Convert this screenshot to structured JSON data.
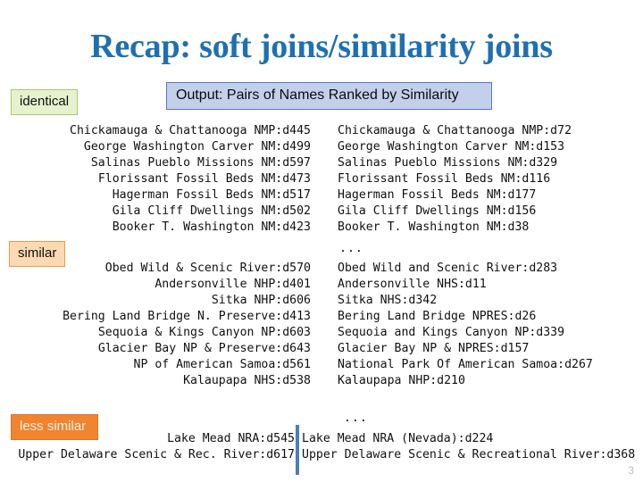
{
  "slide": {
    "title": "Recap: soft joins/similarity joins",
    "page_number": "3",
    "title_color": "#1F6FB2"
  },
  "callouts": {
    "identical": {
      "label": "identical",
      "fill": "#E6F2CE",
      "stroke": "#AFC66A"
    },
    "output": {
      "label": "Output:  Pairs of Names Ranked by Similarity",
      "fill": "#C3CFEB",
      "stroke": "#5578C2"
    },
    "similar": {
      "label": "similar",
      "fill": "#FBD9B3",
      "stroke": "#E89A4B"
    },
    "less_similar": {
      "label": "less similar",
      "fill": "#F0842F",
      "stroke": "#DE7722"
    }
  },
  "markers": {
    "ellipsis_middle": "...",
    "ellipsis_bottom": "..."
  },
  "listings": {
    "identical": {
      "left": [
        "Chickamauga & Chattanooga NMP:d445",
        "George Washington Carver NM:d499",
        "Salinas Pueblo Missions NM:d597",
        "Florissant Fossil Beds NM:d473",
        "Hagerman Fossil Beds NM:d517",
        "Gila Cliff Dwellings NM:d502",
        "Booker T. Washington NM:d423"
      ],
      "right": [
        "Chickamauga & Chattanooga NMP:d72",
        "George Washington Carver NM:d153",
        "Salinas Pueblo Missions NM:d329",
        "Florissant Fossil Beds NM:d116",
        "Hagerman Fossil Beds NM:d177",
        "Gila Cliff Dwellings NM:d156",
        "Booker T. Washington NM:d38"
      ]
    },
    "similar": {
      "left": [
        "Obed Wild & Scenic River:d570",
        "Andersonville NHP:d401",
        "Sitka NHP:d606",
        "Bering Land Bridge N. Preserve:d413",
        "Sequoia & Kings Canyon NP:d603",
        "Glacier Bay NP & Preserve:d643",
        "NP of American Samoa:d561",
        "Kalaupapa NHS:d538"
      ],
      "right": [
        "Obed Wild and Scenic River:d283",
        "Andersonville NHS:d11",
        "Sitka NHS:d342",
        "Bering Land Bridge NPRES:d26",
        "Sequoia and Kings Canyon NP:d339",
        "Glacier Bay NP & NPRES:d157",
        "National Park Of American Samoa:d267",
        "Kalaupapa NHP:d210"
      ]
    },
    "less_similar": {
      "left": [
        "Lake Mead NRA:d545",
        "Upper Delaware Scenic & Rec. River:d617"
      ],
      "right": [
        "Lake Mead NRA (Nevada):d224",
        "Upper Delaware Scenic & Recreational River:d368"
      ]
    }
  }
}
